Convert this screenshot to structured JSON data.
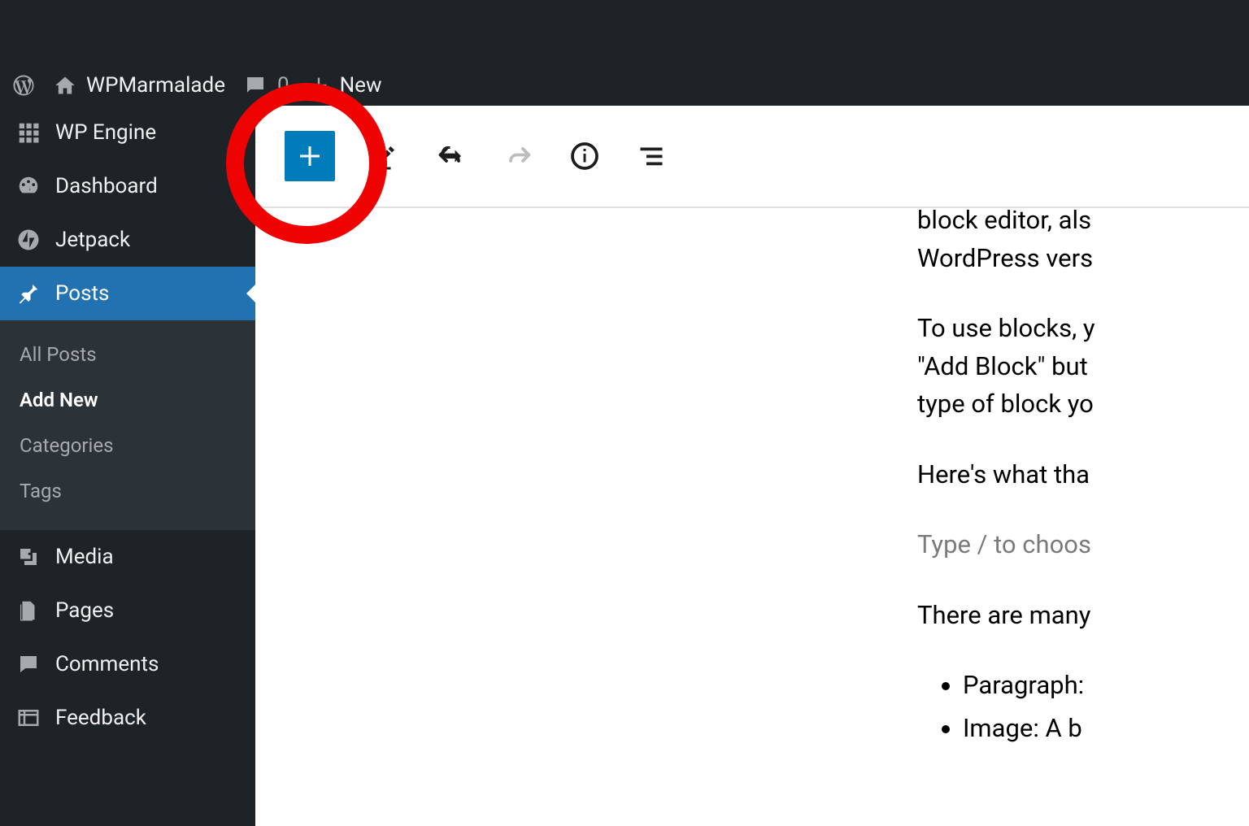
{
  "adminBar": {
    "siteName": "WPMarmalade",
    "commentsCount": "0",
    "newLabel": "New"
  },
  "sidebar": {
    "items": [
      {
        "key": "wpengine",
        "label": "WP Engine"
      },
      {
        "key": "dashboard",
        "label": "Dashboard"
      },
      {
        "key": "jetpack",
        "label": "Jetpack"
      },
      {
        "key": "posts",
        "label": "Posts"
      },
      {
        "key": "media",
        "label": "Media"
      },
      {
        "key": "pages",
        "label": "Pages"
      },
      {
        "key": "comments",
        "label": "Comments"
      },
      {
        "key": "feedback",
        "label": "Feedback"
      }
    ],
    "postsSubmenu": {
      "allPosts": "All Posts",
      "addNew": "Add New",
      "categories": "Categories",
      "tags": "Tags"
    }
  },
  "content": {
    "p1": "block editor, als",
    "p1b": "WordPress vers",
    "p2": "To use blocks, y",
    "p2b": "\"Add Block\" but",
    "p2c": "type of block yo",
    "p3": "Here's what tha",
    "placeholder": "Type / to choos",
    "p4": "There are many",
    "li1": "Paragraph:",
    "li2": "Image: A b"
  }
}
